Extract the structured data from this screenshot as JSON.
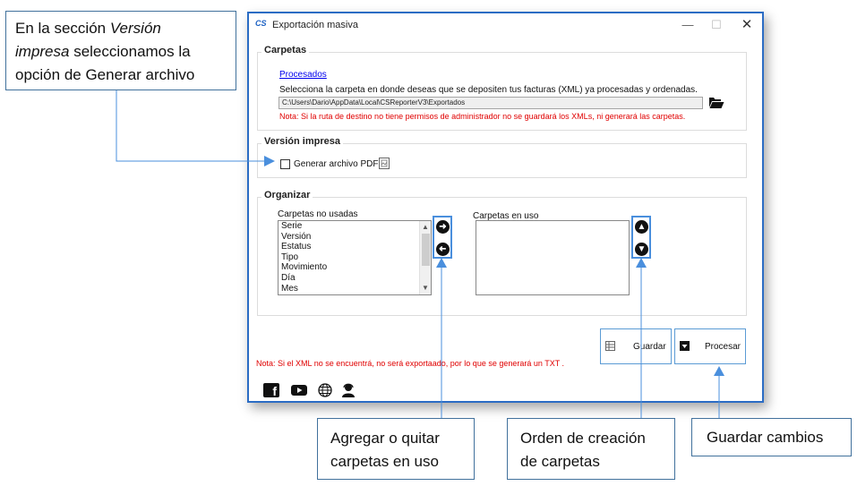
{
  "callouts": {
    "top": {
      "line1": "En la sección ",
      "line1_italic": "Versión",
      "line2_italic": "impresa",
      "line2": " seleccionamos la",
      "line3": "opción de Generar archivo"
    },
    "add": "Agregar o quitar carpetas en uso",
    "order": "Orden de creación de carpetas",
    "save": "Guardar cambios"
  },
  "window": {
    "app_icon": "CS",
    "title": "Exportación masiva",
    "minimize": "—",
    "maximize": "☐",
    "close": "✕"
  },
  "carpetas": {
    "title": "Carpetas",
    "link": "Procesados",
    "description": "Selecciona la carpeta en donde deseas que se depositen tus facturas (XML) ya procesadas y ordenadas.",
    "path": "C:\\Users\\Dario\\AppData\\Local\\CSReporterV3\\Exportados",
    "warning": "Nota: Si la ruta de destino no tiene permisos de administrador no se guardará los XMLs,  ni generará las carpetas."
  },
  "version": {
    "title": "Versión impresa",
    "checkbox_label": "Generar archivo PDF",
    "checked": false
  },
  "organizar": {
    "title": "Organizar",
    "unused_label": "Carpetas no usadas",
    "used_label": "Carpetas en uso",
    "unused_items": [
      "Serie",
      "Versión",
      "Estatus",
      "Tipo",
      "Movimiento",
      "Día",
      "Mes"
    ],
    "used_items": []
  },
  "buttons": {
    "guardar": "Guardar",
    "procesar": "Procesar"
  },
  "footer": {
    "warning": "Nota: Si el XML no se encuentrá, no será exportaado, por lo que se generará un TXT ."
  },
  "colors": {
    "accent": "#4a8fdd",
    "window_border": "#2b6cc4",
    "warning": "#e00000",
    "link": "#0000ee"
  },
  "icons": [
    "folder-open-icon",
    "pdf-preview-icon",
    "arrow-right-icon",
    "arrow-left-icon",
    "arrow-up-icon",
    "arrow-down-icon",
    "save-grid-icon",
    "process-download-icon",
    "facebook-icon",
    "youtube-icon",
    "globe-icon",
    "support-agent-icon"
  ]
}
